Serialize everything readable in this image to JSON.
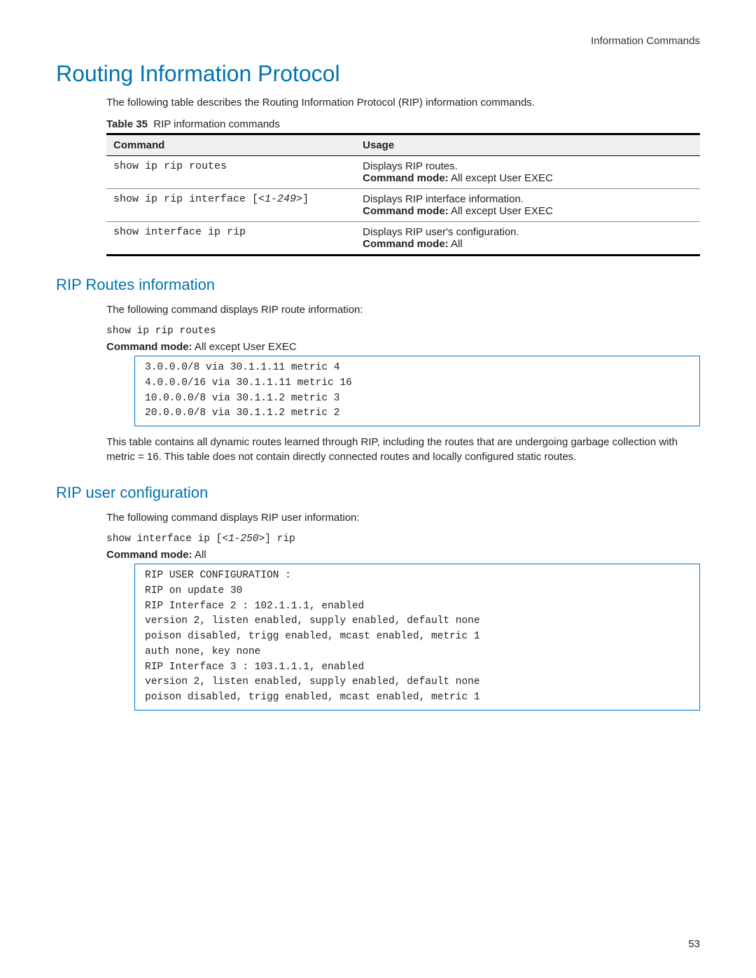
{
  "header": {
    "section": "Information Commands"
  },
  "title": "Routing Information Protocol",
  "intro": "The following table describes the Routing Information Protocol (RIP) information commands.",
  "table": {
    "caption_label": "Table 35",
    "caption_text": "RIP information commands",
    "headers": {
      "command": "Command",
      "usage": "Usage"
    },
    "rows": [
      {
        "command": "show ip rip routes",
        "usage_desc": "Displays RIP routes.",
        "mode_label": "Command mode:",
        "mode_value": "All except User EXEC"
      },
      {
        "command_pre": "show ip rip interface [",
        "command_param": "<1-249>",
        "command_post": "]",
        "usage_desc": "Displays RIP interface information.",
        "mode_label": "Command mode:",
        "mode_value": "All except User EXEC"
      },
      {
        "command": "show interface ip rip",
        "usage_desc": "Displays RIP user's configuration.",
        "mode_label": "Command mode:",
        "mode_value": "All"
      }
    ]
  },
  "section_routes": {
    "heading": "RIP Routes information",
    "intro": "The following command displays RIP route information:",
    "command": "show ip rip routes",
    "mode_label": "Command mode:",
    "mode_value": "All except User EXEC",
    "output": "3.0.0.0/8 via 30.1.1.11 metric 4\n4.0.0.0/16 via 30.1.1.11 metric 16\n10.0.0.0/8 via 30.1.1.2 metric 3\n20.0.0.0/8 via 30.1.1.2 metric 2",
    "explanation": "This table contains all dynamic routes learned through RIP, including the routes that are undergoing garbage collection with metric = 16. This table does not contain directly connected routes and locally configured static routes."
  },
  "section_user": {
    "heading": "RIP user configuration",
    "intro": "The following command displays RIP user information:",
    "command_pre": "show interface ip [",
    "command_param": "<1-250>",
    "command_post": "] rip",
    "mode_label": "Command mode:",
    "mode_value": "All",
    "output": "RIP USER CONFIGURATION :\nRIP on update 30\nRIP Interface 2 : 102.1.1.1, enabled\nversion 2, listen enabled, supply enabled, default none\npoison disabled, trigg enabled, mcast enabled, metric 1\nauth none, key none\nRIP Interface 3 : 103.1.1.1, enabled\nversion 2, listen enabled, supply enabled, default none\npoison disabled, trigg enabled, mcast enabled, metric 1"
  },
  "page_number": "53"
}
